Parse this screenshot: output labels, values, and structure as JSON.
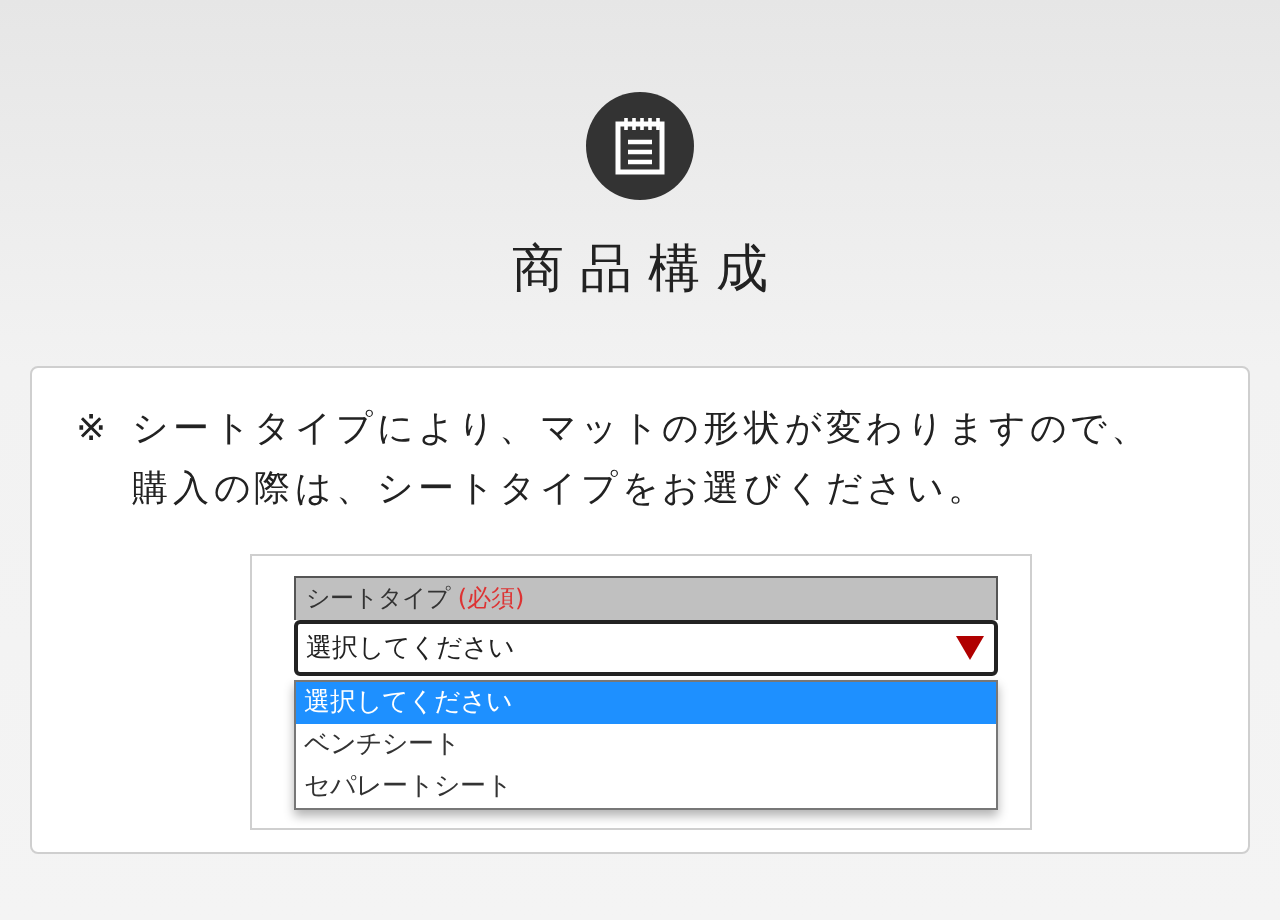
{
  "heading": {
    "title": "商品構成"
  },
  "notice": {
    "mark": "※",
    "lines": [
      "シートタイプにより、マットの形状が変わりますので、",
      "購入の際は、シートタイプをお選びください。"
    ]
  },
  "form": {
    "label": "シートタイプ",
    "required": "(必須)",
    "select": {
      "value": "選択してください",
      "expanded": true
    },
    "options": [
      {
        "label": "選択してください",
        "selected": true
      },
      {
        "label": "ベンチシート",
        "selected": false
      },
      {
        "label": "セパレートシート",
        "selected": false
      }
    ]
  }
}
